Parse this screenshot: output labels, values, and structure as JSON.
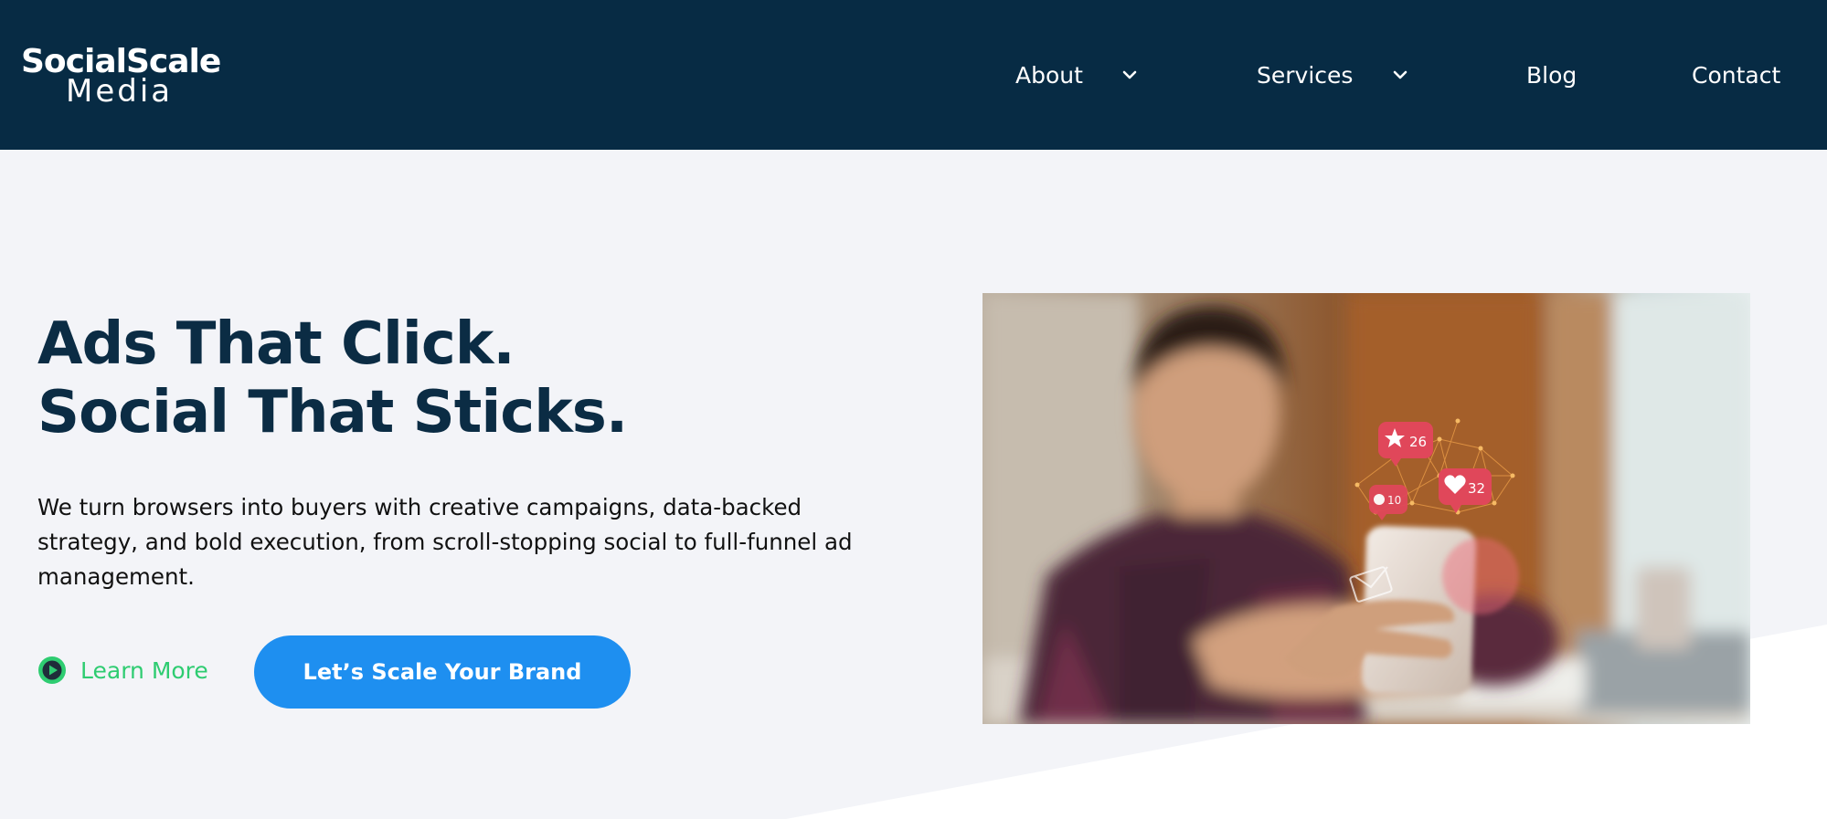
{
  "header": {
    "logo": {
      "line1": "SocialScale",
      "line2": "Media"
    },
    "nav": [
      {
        "label": "About",
        "has_dropdown": true
      },
      {
        "label": "Services",
        "has_dropdown": true
      },
      {
        "label": "Blog",
        "has_dropdown": false
      },
      {
        "label": "Contact",
        "has_dropdown": false
      }
    ]
  },
  "hero": {
    "headline_line1": "Ads That Click.",
    "headline_line2": "Social That Sticks.",
    "description": "We turn browsers into buyers with creative campaigns, data-backed strategy, and bold execution, from scroll-stopping social to full-funnel ad management.",
    "learn_more_label": "Learn More",
    "cta_label": "Let’s Scale Your Brand",
    "image": {
      "description_icons": [
        "star-reaction-icon",
        "heart-reaction-icon",
        "comment-reaction-icon",
        "mail-icon"
      ],
      "badges": {
        "star_count": "26",
        "heart_count": "32",
        "comment_count": "10"
      }
    }
  },
  "colors": {
    "header_bg": "#072b44",
    "hero_bg": "#f3f4f8",
    "headline": "#0b2c44",
    "accent_green": "#2ecc71",
    "cta_blue": "#1e8ff0",
    "reaction_red": "#e0475a"
  }
}
